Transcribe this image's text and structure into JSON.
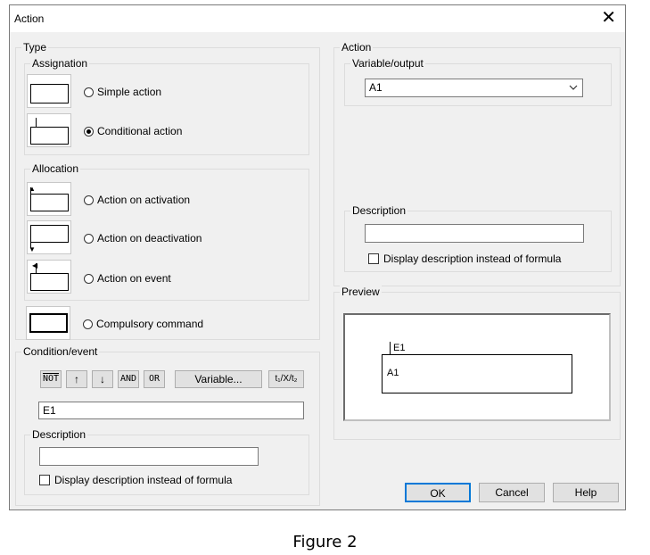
{
  "window": {
    "title": "Action",
    "close_symbol": "✕"
  },
  "type_group": {
    "label": "Type",
    "assignation": {
      "label": "Assignation",
      "options": [
        {
          "label": "Simple action",
          "selected": false
        },
        {
          "label": "Conditional action",
          "selected": true
        }
      ]
    },
    "allocation": {
      "label": "Allocation",
      "options": [
        {
          "label": "Action on activation",
          "selected": false
        },
        {
          "label": "Action on deactivation",
          "selected": false
        },
        {
          "label": "Action on event",
          "selected": false
        }
      ]
    },
    "compulsory": {
      "label": "Compulsory command",
      "selected": false
    }
  },
  "condition_group": {
    "label": "Condition/event",
    "buttons": {
      "not": "NOT",
      "up": "↑",
      "down": "↓",
      "and": "AND",
      "or": "OR",
      "variable": "Variable...",
      "time": "t₁/X/t₂"
    },
    "value": "E1",
    "description": {
      "label": "Description",
      "value": "",
      "checkbox_label": "Display description instead of formula",
      "checked": false
    }
  },
  "action_group": {
    "label": "Action",
    "variable": {
      "label": "Variable/output",
      "value": "A1"
    },
    "description": {
      "label": "Description",
      "value": "",
      "checkbox_label": "Display description instead of formula",
      "checked": false
    }
  },
  "preview": {
    "label": "Preview",
    "condition_text": "E1",
    "action_text": "A1"
  },
  "footer": {
    "ok": "OK",
    "cancel": "Cancel",
    "help": "Help"
  },
  "caption": "Figure 2"
}
